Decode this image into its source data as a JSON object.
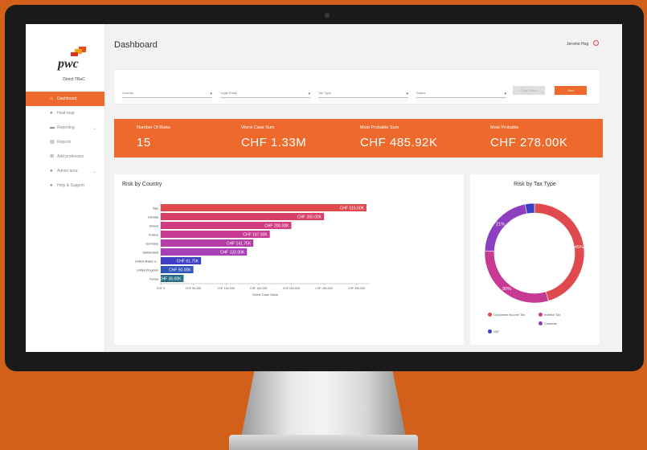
{
  "app": {
    "logo_text": "pwc",
    "user_name": "Direct TRaC",
    "page_title": "Dashboard",
    "top_user": "Jerome Hug"
  },
  "sidebar": {
    "items": [
      {
        "label": "Dashboard",
        "icon": "home-icon",
        "active": true
      },
      {
        "label": "Heat map",
        "icon": "pin-icon"
      },
      {
        "label": "Reporting",
        "icon": "folder-icon",
        "chevron": true
      },
      {
        "label": "Reports",
        "icon": "report-icon"
      },
      {
        "label": "Add profession",
        "icon": "add-icon"
      },
      {
        "label": "Admin area",
        "icon": "admin-icon",
        "chevron": true
      },
      {
        "label": "Help & Support",
        "icon": "help-icon"
      }
    ]
  },
  "filters": {
    "country": "Country",
    "legal_entity": "Legal Entity",
    "tax_type": "Tax Type",
    "status": "Status",
    "clear_label": "Clear Filters",
    "apply_label": "Run"
  },
  "kpis": [
    {
      "label": "Number Of Risks",
      "value": "15"
    },
    {
      "label": "Worst Case Sum",
      "value": "CHF 1.33M"
    },
    {
      "label": "Most Probable Sum",
      "value": "CHF 485.92K"
    },
    {
      "label": "Most Probable",
      "value": "CHF 278.00K"
    }
  ],
  "colors": {
    "accent": "#ee6a2c",
    "bars": [
      "#e04a4e",
      "#d94067",
      "#d13b7f",
      "#c73a93",
      "#b43ea6",
      "#a83fb5",
      "#3c3ec4",
      "#2f55b8",
      "#2a6e86"
    ],
    "pie": [
      "#e04a4e",
      "#c73a93",
      "#8e3fbf",
      "#3c3ec4"
    ]
  },
  "chart_data": [
    {
      "type": "bar",
      "title": "Risk by Country",
      "xlabel": "Worst Case Value",
      "orientation": "horizontal",
      "categories": [
        "Italy",
        "Canada",
        "Ghana",
        "France",
        "Germany",
        "Switzerland",
        "United States o...",
        "United Kingdom",
        "Kenya"
      ],
      "values": [
        315000,
        250000,
        200000,
        167000,
        141750,
        132000,
        61750,
        50000,
        35000
      ],
      "data_labels": [
        "CHF 315.00K",
        "CHF 250.00K",
        "CHF 200.00K",
        "CHF 167.00K",
        "CHF 141.75K",
        "CHF 132.00K",
        "CHF 61.75K",
        "CHF 50.00K",
        "CHF 35.00K"
      ],
      "xlim": [
        0,
        320000
      ],
      "x_ticks": [
        0,
        50000,
        100000,
        150000,
        200000,
        250000,
        300000
      ],
      "x_tick_labels": [
        "CHF 0",
        "CHF 50.00K",
        "CHF 100.00K",
        "CHF 150.00K",
        "CHF 200.00K",
        "CHF 250.00K",
        "CHF 300.00K"
      ]
    },
    {
      "type": "pie",
      "title": "Risk by Tax Type",
      "donut": true,
      "categories": [
        "Corporate Income Tax",
        "Indirect Tax",
        "Customs",
        "VAT"
      ],
      "values": [
        45,
        30,
        21,
        3
      ],
      "data_labels": [
        "45%",
        "30%",
        "21%",
        ""
      ],
      "legend_position": "bottom"
    }
  ]
}
